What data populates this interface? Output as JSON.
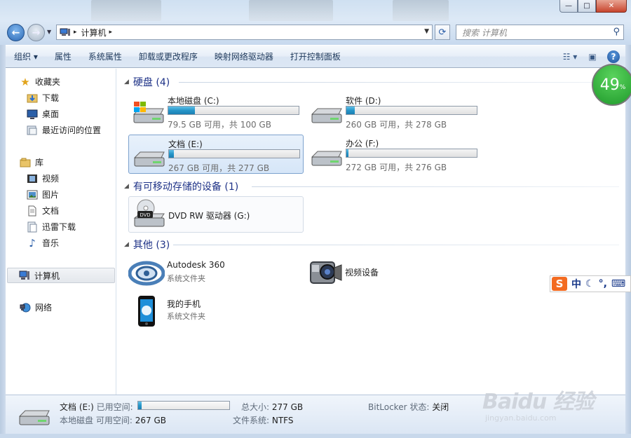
{
  "window": {
    "controls": [
      "—",
      "□",
      "✕"
    ]
  },
  "address": {
    "location": "计算机",
    "separator": "▸",
    "dropdown": "▼",
    "refresh": "⟳"
  },
  "search": {
    "placeholder": "搜索 计算机"
  },
  "toolbar": {
    "organize": "组织 ▾",
    "properties": "属性",
    "system_properties": "系统属性",
    "uninstall": "卸载或更改程序",
    "map_drive": "映射网络驱动器",
    "control_panel": "打开控制面板",
    "help": "?"
  },
  "sidebar": {
    "favorites": "收藏夹",
    "downloads": "下载",
    "desktop": "桌面",
    "recent": "最近访问的位置",
    "libraries": "库",
    "videos": "视频",
    "pictures": "图片",
    "documents": "文档",
    "xunlei": "迅雷下载",
    "music": "音乐",
    "computer": "计算机",
    "network": "网络"
  },
  "groups": {
    "hard_disks": "硬盘 (4)",
    "removable": "有可移动存储的设备 (1)",
    "other": "其他 (3)"
  },
  "drives": [
    {
      "name": "本地磁盘 (C:)",
      "free_text": "79.5 GB 可用，共 100 GB",
      "used_fraction": 0.205
    },
    {
      "name": "软件 (D:)",
      "free_text": "260 GB 可用，共 278 GB",
      "used_fraction": 0.065
    },
    {
      "name": "文档 (E:)",
      "free_text": "267 GB 可用，共 277 GB",
      "used_fraction": 0.036
    },
    {
      "name": "办公 (F:)",
      "free_text": "272 GB 可用，共 276 GB",
      "used_fraction": 0.015
    }
  ],
  "removable": {
    "name": "DVD RW 驱动器 (G:)",
    "badge": "DVD"
  },
  "other_items": {
    "autodesk": {
      "name": "Autodesk 360",
      "sub": "系统文件夹"
    },
    "video_device": {
      "name": "视频设备"
    },
    "phone": {
      "name": "我的手机",
      "sub": "系统文件夹"
    }
  },
  "details": {
    "title": "文档 (E:)",
    "type": "本地磁盘",
    "used_label": "已用空间:",
    "free_label": "可用空间:",
    "free_value": "267 GB",
    "total_label": "总大小:",
    "total_value": "277 GB",
    "fs_label": "文件系统:",
    "fs_value": "NTFS",
    "bitlocker_label": "BitLocker 状态:",
    "bitlocker_value": "关闭",
    "used_fraction": 0.036
  },
  "overlays": {
    "speed_value": "49",
    "speed_unit": "%",
    "ime_logo": "S",
    "ime_lang": "中",
    "ime_moon": "☾",
    "ime_punct": "°,",
    "ime_kbd": "⌨",
    "watermark_logo": "Baidu 经验",
    "watermark_url": "jingyan.baidu.com"
  },
  "colors": {
    "accent_blue": "#1e3287",
    "bar_fill": "#2796c9",
    "speed_green": "#1f9a2b",
    "ime_orange": "#f36b21"
  }
}
